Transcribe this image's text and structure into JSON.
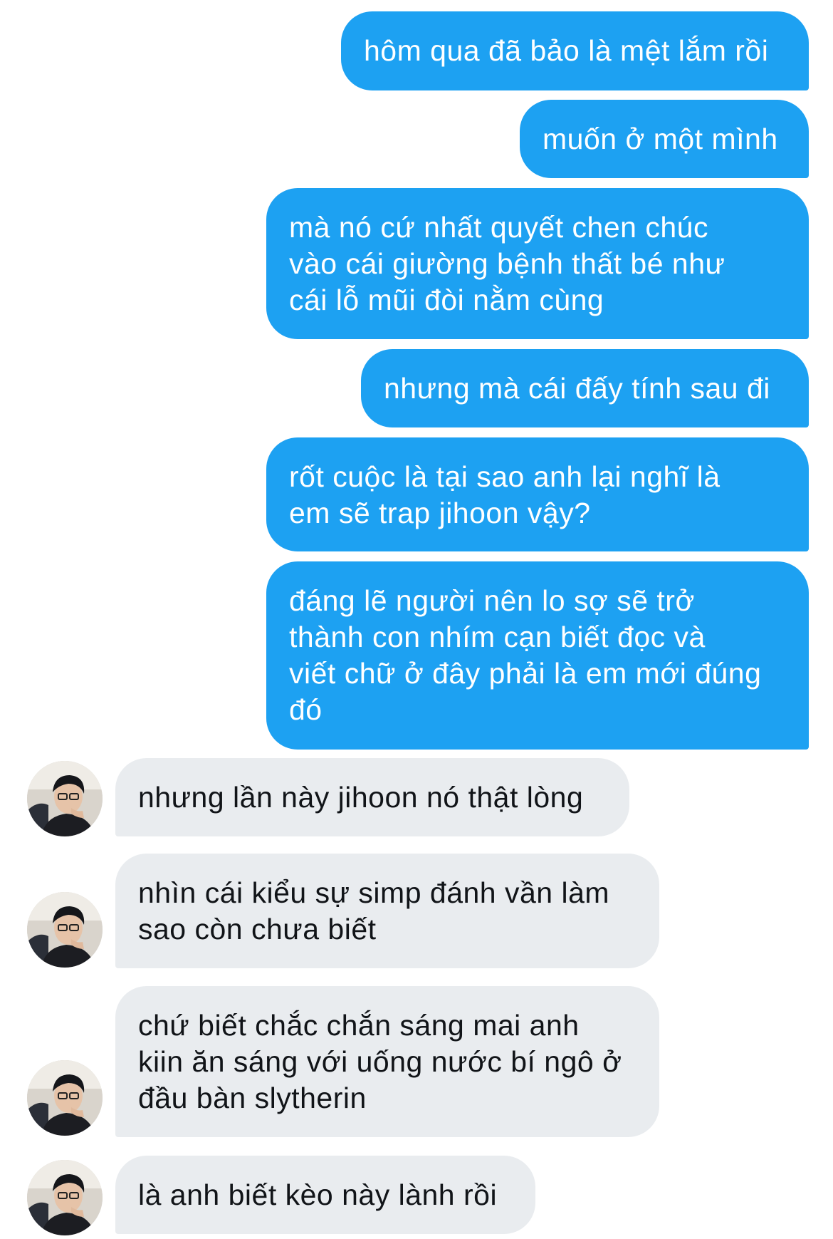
{
  "conversation": {
    "messages": [
      {
        "direction": "outgoing",
        "text": "hôm qua đã bảo là mệt lắm rồi"
      },
      {
        "direction": "outgoing",
        "text": "muốn ở một mình"
      },
      {
        "direction": "outgoing",
        "text": "mà nó cứ nhất quyết chen chúc\nvào cái giường bệnh thất bé như\ncái lỗ mũi đòi nằm cùng"
      },
      {
        "direction": "outgoing",
        "text": "nhưng mà cái đấy tính sau đi"
      },
      {
        "direction": "outgoing",
        "text": "rốt cuộc là tại sao anh lại nghĩ là\nem sẽ trap jihoon vậy?"
      },
      {
        "direction": "outgoing",
        "text": "đáng lẽ người nên lo sợ sẽ trở\nthành con nhím cạn biết đọc và\nviết chữ ở đây phải là em mới đúng\nđó"
      },
      {
        "direction": "incoming",
        "text": "nhưng lần này jihoon nó thật lòng"
      },
      {
        "direction": "incoming",
        "text": "nhìn cái kiểu sự simp đánh vần làm\nsao còn chưa biết"
      },
      {
        "direction": "incoming",
        "text": "chứ biết chắc chắn sáng mai anh\nkiin ăn sáng với uống nước bí ngô ở\nđầu bàn slytherin"
      },
      {
        "direction": "incoming",
        "text": "là anh biết kèo này lành rồi"
      }
    ]
  },
  "colors": {
    "outgoing_bubble": "#1da1f2",
    "incoming_bubble": "#e9ecef",
    "outgoing_text": "#ffffff",
    "incoming_text": "#111418"
  },
  "icons": {
    "avatar": "person-avatar-photo"
  }
}
